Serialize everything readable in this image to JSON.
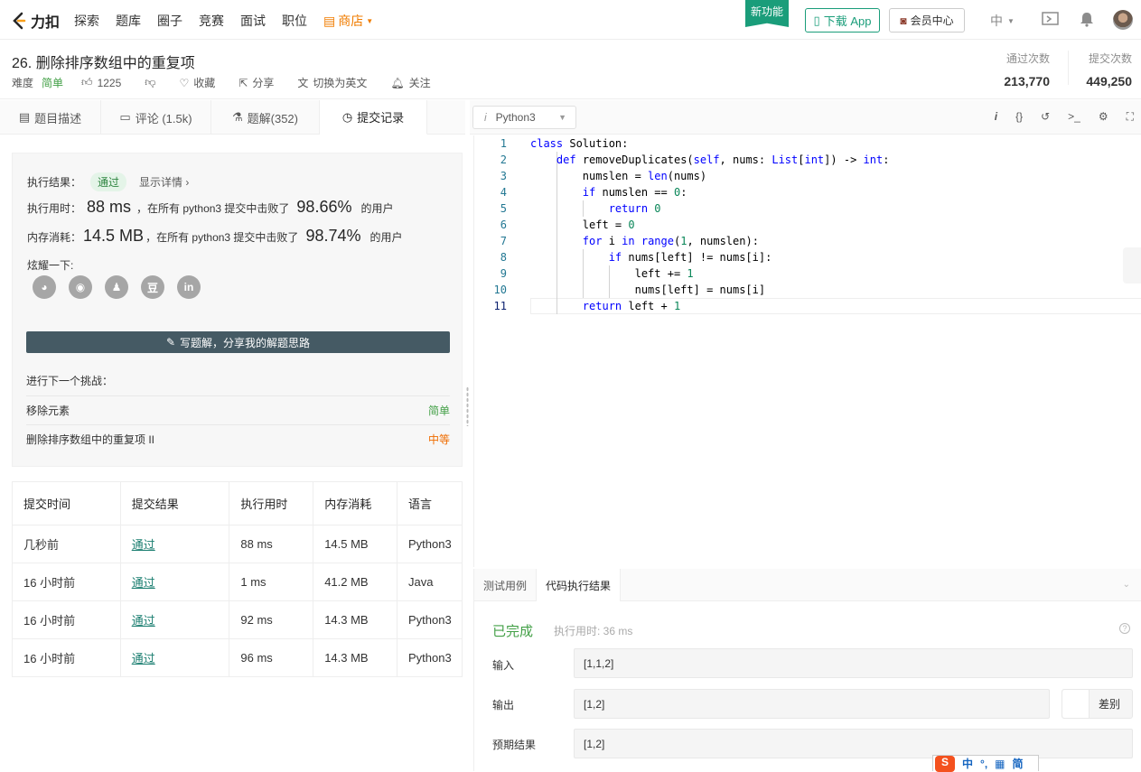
{
  "nav": {
    "logo_text": "力扣",
    "items": [
      "探索",
      "题库",
      "圈子",
      "竞赛",
      "面试",
      "职位"
    ],
    "store": "商店",
    "new_feature": "新功能",
    "download_app": "下载 App",
    "member_center": "会员中心",
    "language": "中"
  },
  "problem": {
    "title": "26. 删除排序数组中的重复项",
    "difficulty_label": "难度",
    "difficulty": "简单",
    "likes": "1225",
    "favorite": "收藏",
    "share": "分享",
    "switch_english": "切换为英文",
    "follow": "关注",
    "accepted_label": "通过次数",
    "accepted": "213,770",
    "submissions_label": "提交次数",
    "submissions": "449,250"
  },
  "tabs": [
    "题目描述",
    "评论 (1.5k)",
    "题解(352)",
    "提交记录"
  ],
  "result": {
    "label": "执行结果：",
    "status": "通过",
    "show_detail": "显示详情 ›",
    "runtime_label": "执行用时：",
    "runtime": "88 ms",
    "runtime_mid": "，在所有 python3 提交中击败了",
    "runtime_pct": "98.66%",
    "users_suffix": "的用户",
    "memory_label": "内存消耗：",
    "memory": "14.5 MB",
    "memory_mid": "，在所有 python3 提交中击败了",
    "memory_pct": "98.74%",
    "show_off": "炫耀一下:",
    "share_icons": [
      "wechat-icon",
      "weibo-icon",
      "qq-icon",
      "douban-icon",
      "linkedin-icon"
    ],
    "write_solution": "写题解，分享我的解题思路",
    "next_challenge": "进行下一个挑战：",
    "next": [
      {
        "name": "移除元素",
        "difficulty": "简单"
      },
      {
        "name": "删除排序数组中的重复项 II",
        "difficulty": "中等"
      }
    ]
  },
  "submissions": {
    "headers": [
      "提交时间",
      "提交结果",
      "执行用时",
      "内存消耗",
      "语言"
    ],
    "rows": [
      [
        "几秒前",
        "通过",
        "88 ms",
        "14.5 MB",
        "Python3"
      ],
      [
        "16 小时前",
        "通过",
        "1 ms",
        "41.2 MB",
        "Java"
      ],
      [
        "16 小时前",
        "通过",
        "92 ms",
        "14.3 MB",
        "Python3"
      ],
      [
        "16 小时前",
        "通过",
        "96 ms",
        "14.3 MB",
        "Python3"
      ]
    ]
  },
  "editor": {
    "language": "Python3",
    "toolbar_icons": [
      "info-icon",
      "braces-icon",
      "reset-icon",
      "console-icon",
      "settings-icon",
      "fullscreen-icon"
    ],
    "lines": [
      "class Solution:",
      "    def removeDuplicates(self, nums: List[int]) -> int:",
      "        numslen = len(nums)",
      "        if numslen == 0:",
      "            return 0",
      "        left = 0",
      "        for i in range(1, numslen):",
      "            if nums[left] != nums[i]:",
      "                left += 1",
      "                nums[left] = nums[i]",
      "        return left + 1"
    ]
  },
  "console": {
    "tabs": [
      "测试用例",
      "代码执行结果"
    ],
    "status": "已完成",
    "exec_time": "执行用时: 36 ms",
    "input_label": "输入",
    "input": "[1,1,2]",
    "output_label": "输出",
    "output": "[1,2]",
    "diff": "差别",
    "expected_label": "预期结果",
    "expected": "[1,2]"
  },
  "ime": {
    "chars": [
      "中",
      "°,",
      "▦",
      "简"
    ]
  }
}
